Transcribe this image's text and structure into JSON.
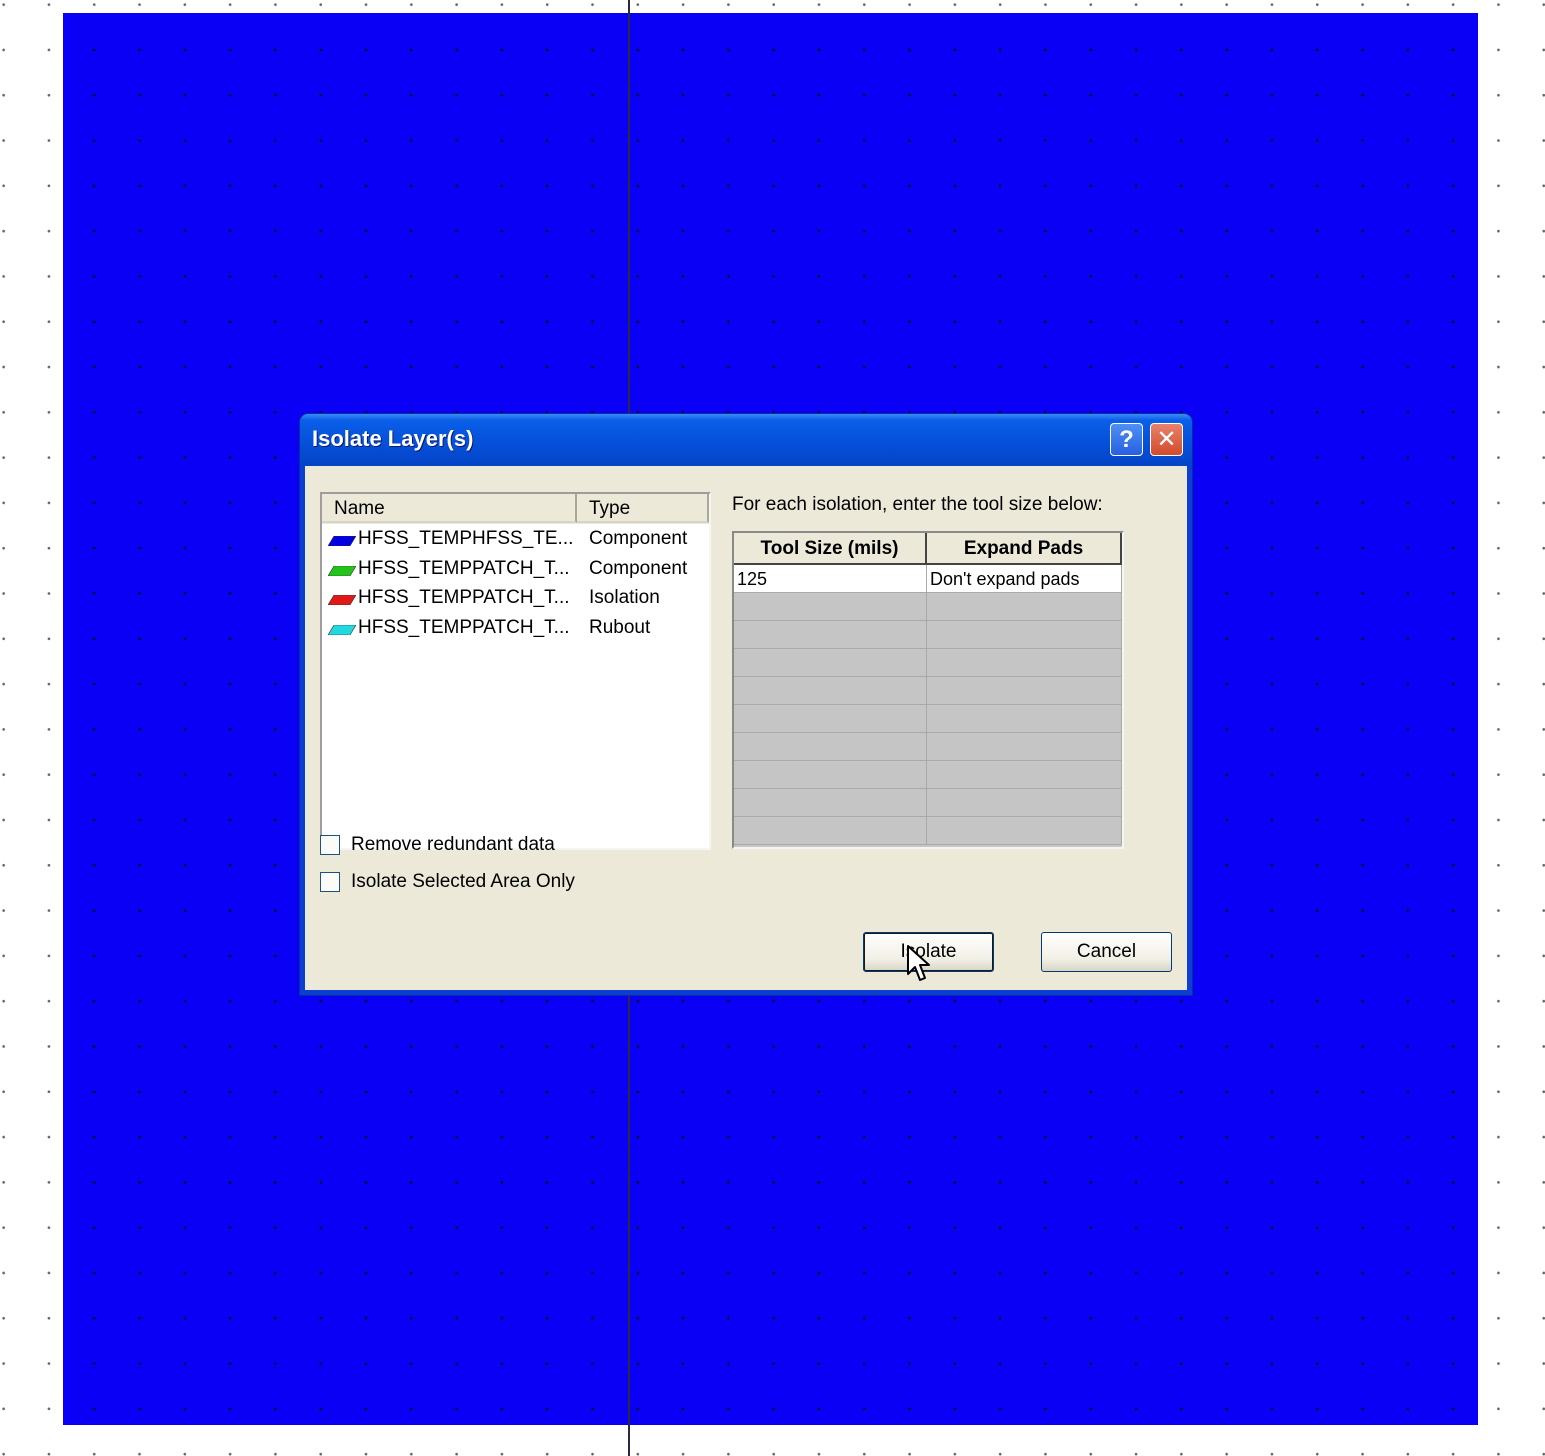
{
  "dialog": {
    "title": "Isolate Layer(s)",
    "help_symbol": "?",
    "close_symbol": "✕"
  },
  "layer_list": {
    "columns": [
      "Name",
      "Type"
    ],
    "rows": [
      {
        "name": "HFSS_TEMPHFSS_TE...",
        "type": "Component",
        "color": "#0000e0"
      },
      {
        "name": "HFSS_TEMPPATCH_T...",
        "type": "Component",
        "color": "#22c41a"
      },
      {
        "name": "HFSS_TEMPPATCH_T...",
        "type": "Isolation",
        "color": "#e01818"
      },
      {
        "name": "HFSS_TEMPPATCH_T...",
        "type": "Rubout",
        "color": "#20d8e0"
      }
    ]
  },
  "tool_grid": {
    "instruction": "For each isolation, enter the tool size below:",
    "columns": [
      "Tool Size (mils)",
      "Expand Pads"
    ],
    "rows": [
      {
        "tool_size": "125",
        "expand": "Don't expand pads"
      }
    ]
  },
  "options": {
    "remove_redundant": {
      "label": "Remove redundant data",
      "checked": false
    },
    "isolate_selected": {
      "label": "Isolate Selected Area Only",
      "checked": false
    }
  },
  "buttons": {
    "isolate": "Isolate",
    "cancel": "Cancel"
  }
}
